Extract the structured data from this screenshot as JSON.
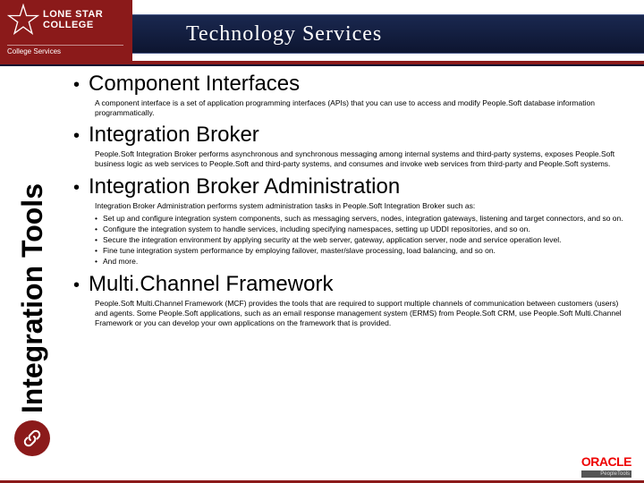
{
  "header": {
    "logo_line1": "LONE STAR",
    "logo_line2": "COLLEGE",
    "logo_sub": "College Services",
    "banner": "Technology Services"
  },
  "side_title": "Integration Tools",
  "items": [
    {
      "head": "Component Interfaces",
      "desc": "A component interface is a set of application programming interfaces (APIs) that you can use to access and modify People.Soft database information programmatically."
    },
    {
      "head": "Integration Broker",
      "desc": "People.Soft Integration Broker performs asynchronous and synchronous messaging among internal systems and third-party systems, exposes People.Soft business logic as web services to People.Soft and third-party systems, and consumes and invoke web services from third-party and People.Soft systems."
    },
    {
      "head": "Integration Broker Administration",
      "desc": "Integration Broker Administration performs system administration tasks in People.Soft Integration Broker such as:",
      "sub": [
        "Set up and configure integration system components, such as messaging servers, nodes, integration gateways, listening and target connectors, and so on.",
        "Configure the integration system to handle services, including specifying namespaces, setting up UDDI repositories, and so on.",
        "Secure the integration environment by applying security at the web server, gateway, application server, node and service operation level.",
        "Fine tune integration system performance by employing failover, master/slave processing, load balancing, and so on.",
        "And more."
      ]
    },
    {
      "head": "Multi.Channel Framework",
      "desc": "People.Soft Multi.Channel Framework (MCF) provides the tools that are required to support multiple channels of communication between customers (users) and agents. Some People.Soft applications, such as an email response management system (ERMS) from People.Soft CRM, use People.Soft Multi.Channel Framework or you can develop your own applications on the framework that is provided."
    }
  ],
  "footer": {
    "brand": "ORACLE",
    "product": "PeopleTools"
  }
}
